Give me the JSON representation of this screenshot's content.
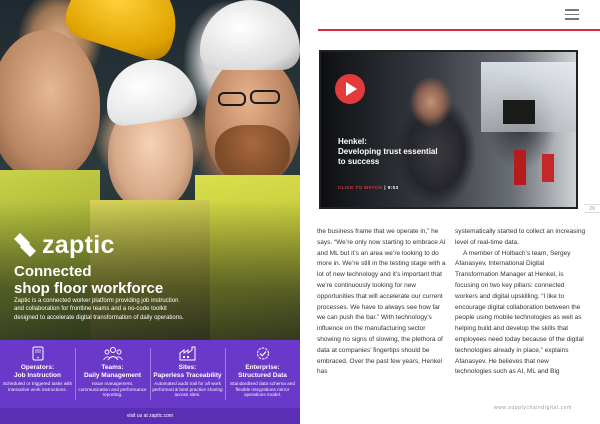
{
  "ad": {
    "brand": "zaptic",
    "headline_line1": "Connected",
    "headline_line2": "shop floor workforce",
    "lead": "Zaptic is a connected worker platform providing job instruction and collaboration for frontline teams and a no-code toolkit designed to accelerate digital transformation of daily operations.",
    "features": [
      {
        "icon": "tablet-icon",
        "title_line1": "Operators:",
        "title_line2": "Job Instruction",
        "desc": "Scheduled or triggered tasks with interactive work instructions."
      },
      {
        "icon": "team-icon",
        "title_line1": "Teams:",
        "title_line2": "Daily Management",
        "desc": "Issue management, communication and performance reporting."
      },
      {
        "icon": "factory-icon",
        "title_line1": "Sites:",
        "title_line2": "Paperless Traceability",
        "desc": "Automated audit trail for all work performed & best practice sharing across sites."
      },
      {
        "icon": "check-gear-icon",
        "title_line1": "Enterprise:",
        "title_line2": "Structured Data",
        "desc": "Standardised data schema and flexible integrations mirror operations model."
      }
    ],
    "footer": "visit us at zaptic.com"
  },
  "video": {
    "title_line1": "Henkel:",
    "title_line2": "Developing trust essential",
    "title_line3": "to success",
    "cta": "CLICK TO WATCH",
    "separator": "|",
    "duration": "9:03"
  },
  "page_number": "29",
  "article": {
    "col1": "the business frame that we operate in,” he says. “We’re only now starting to embrace AI and ML but it’s an area we’re looking to do more in. We’re still in the testing stage with a lot of new technology and it’s important that we’re continuously looking for new opportunities that will accelerate our current processes. We have to always see how far we can push the bar.” With technology’s influence on the manufacturing sector showing no signs of slowing, the plethora of data at companies’ fingertips should be embraced. Over the past few years, Henkel has",
    "col2_p1": "systematically started to collect an increasing level of real-time data.",
    "col2_p2": "A member of Holbach’s team, Sergey Afanasyev, International Digital Transformation Manager at Henkel, is focusing on two key pillars: connected workers and digital upskilling. “I like to encourage digital collaboration between the people using mobile technologies as well as helping build and develop the skills that employees need today because of the digital technologies already in place,” explains Afanasyev. He believes that new technologies such as AI, ML and Big"
  },
  "site_url": "www.supplychaindigital.com",
  "colors": {
    "accent_red": "#d9283a",
    "play_red": "#e23b3b",
    "ad_purple": "#6a39c9"
  }
}
